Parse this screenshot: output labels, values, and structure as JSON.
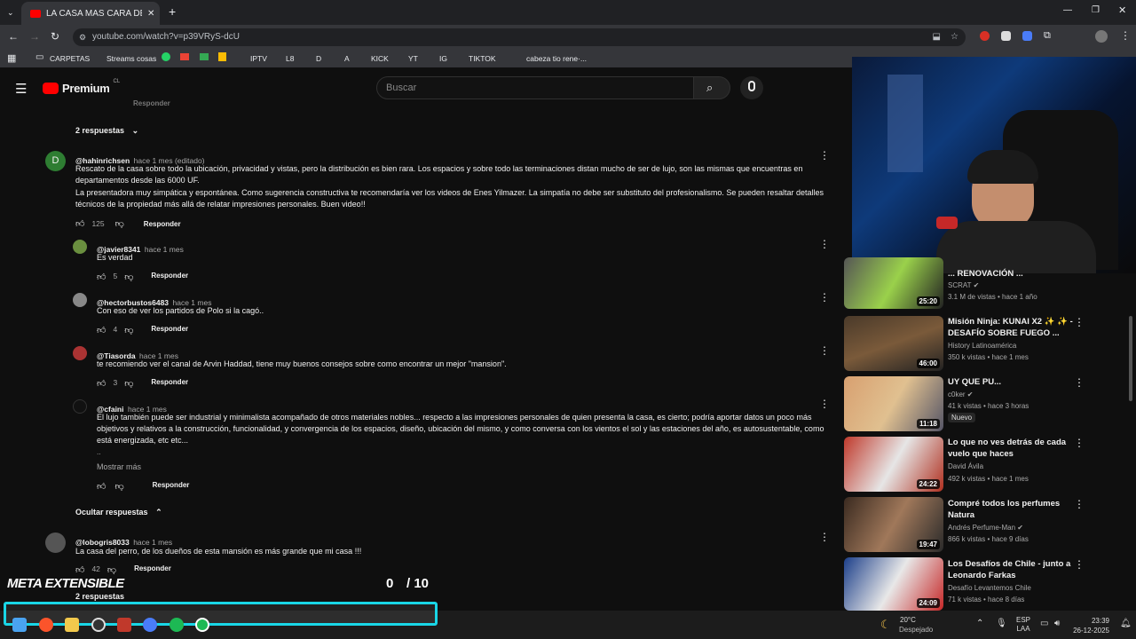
{
  "browser": {
    "tab_title": "LA CASA MAS CARA DE TOI",
    "url": "youtube.com/watch?v=p39VRyS-dcU",
    "bookmarks": [
      "CARPETAS",
      "Streams cosas",
      "IPTV",
      "L8",
      "D",
      "A",
      "KICK",
      "YT",
      "IG",
      "TIKTOK",
      "cabeza tio rene·..."
    ]
  },
  "youtube": {
    "logo_text": "Premium",
    "country": "CL",
    "search_placeholder": "Buscar"
  },
  "comments": {
    "top_reply_label": "Responder",
    "replies_toggle_1": "2 respuestas",
    "main": {
      "user": "@hahinrichsen",
      "meta": "hace 1 mes (editado)",
      "avatar_letter": "D",
      "text_1": "Rescato de la casa sobre todo la ubicación, privacidad y vistas, pero la distribución es bien rara. Los espacios y sobre todo las terminaciones distan mucho de ser de lujo, son las mismas que encuentras en departamentos desde las 6000 UF.",
      "text_2": "La presentadora muy simpática y espontánea. Como sugerencia constructiva te recomendaría ver los videos de Enes Yilmazer. La simpatía no debe ser substituto del profesionalismo. Se pueden resaltar detalles técnicos de la propiedad más allá de relatar impresiones personales. Buen video!!",
      "likes": "125",
      "reply": "Responder"
    },
    "replies": [
      {
        "user": "@javier8341",
        "meta": "hace 1 mes",
        "text": "Es verdad",
        "likes": "5",
        "reply": "Responder"
      },
      {
        "user": "@hectorbustos6483",
        "meta": "hace 1 mes",
        "text": "Con eso de ver los partidos de Polo si la cagó..",
        "likes": "4",
        "reply": "Responder"
      },
      {
        "user": "@Tiasorda",
        "meta": "hace 1 mes",
        "text": "te recomiendo ver el canal de Arvin Haddad, tiene muy buenos consejos sobre como encontrar un mejor \"mansion\".",
        "likes": "3",
        "reply": "Responder"
      }
    ],
    "long_reply": {
      "user": "@cfaini",
      "meta": "hace 1 mes",
      "text": "El lujo también puede ser industrial y minimalista acompañado de otros materiales nobles... respecto a las impresiones personales de quien presenta la casa, es cierto; podría aportar datos un poco más objetivos y relativos a la construcción, funcionalidad, y convergencia de los espacios, diseño, ubicación del mismo, y como conversa con los vientos el sol y las estaciones del año, es autosustentable, como está energizada, etc etc...",
      "ellipsis": "..",
      "more": "Mostrar más",
      "reply": "Responder"
    },
    "hide_replies": "Ocultar respuestas",
    "last": {
      "user": "@lobogris8033",
      "meta": "hace 1 mes",
      "text": "La casa del perro, de los dueños de esta mansión es más grande que mi casa !!!",
      "likes": "42",
      "reply": "Responder",
      "replies_toggle": "2 respuestas"
    }
  },
  "sidebar": [
    {
      "title": "... RENOVACIÓN ...",
      "channel": "SCRAT",
      "stats": "3.1 M de vistas • hace 1 año",
      "duration": "25:20"
    },
    {
      "title_1": "Misión Ninja: KUNAI X2 ✨ ✨ -",
      "title_2": "DESAFÍO SOBRE FUEGO ...",
      "channel": "History Latinoamérica",
      "stats": "350 k vistas • hace 1 mes",
      "duration": "46:00"
    },
    {
      "title": "UY QUE PU...",
      "channel": "c0ker",
      "stats": "41 k vistas • hace 3 horas",
      "badge": "Nuevo",
      "duration": "11:18"
    },
    {
      "title_1": "Lo que no ves detrás de cada",
      "title_2": "vuelo que haces",
      "channel": "David Ávila",
      "stats": "492 k vistas • hace 1 mes",
      "duration": "24:22"
    },
    {
      "title_1": "Compré todos los perfumes",
      "title_2": "Natura",
      "channel": "Andrés Perfume-Man",
      "stats": "866 k vistas • hace 9 días",
      "duration": "19:47"
    },
    {
      "title_1": "Los Desafíos de Chile - junto a",
      "title_2": "Leonardo Farkas",
      "channel": "Desafío Levantemos Chile",
      "stats": "71 k vistas • hace 8 días",
      "duration": "24:09"
    }
  ],
  "overlay": {
    "meta_label": "META EXTENSIBLE",
    "count": "0",
    "total": "/ 10"
  },
  "taskbar": {
    "temp": "20°C",
    "weather": "Despejado",
    "lang_1": "ESP",
    "lang_2": "LAA",
    "time": "23:39",
    "date": "26-12-2025"
  },
  "colors": {
    "youtube_red": "#ff0000",
    "bg": "#0f0f0f",
    "overlay_cyan": "#19d6e6"
  }
}
